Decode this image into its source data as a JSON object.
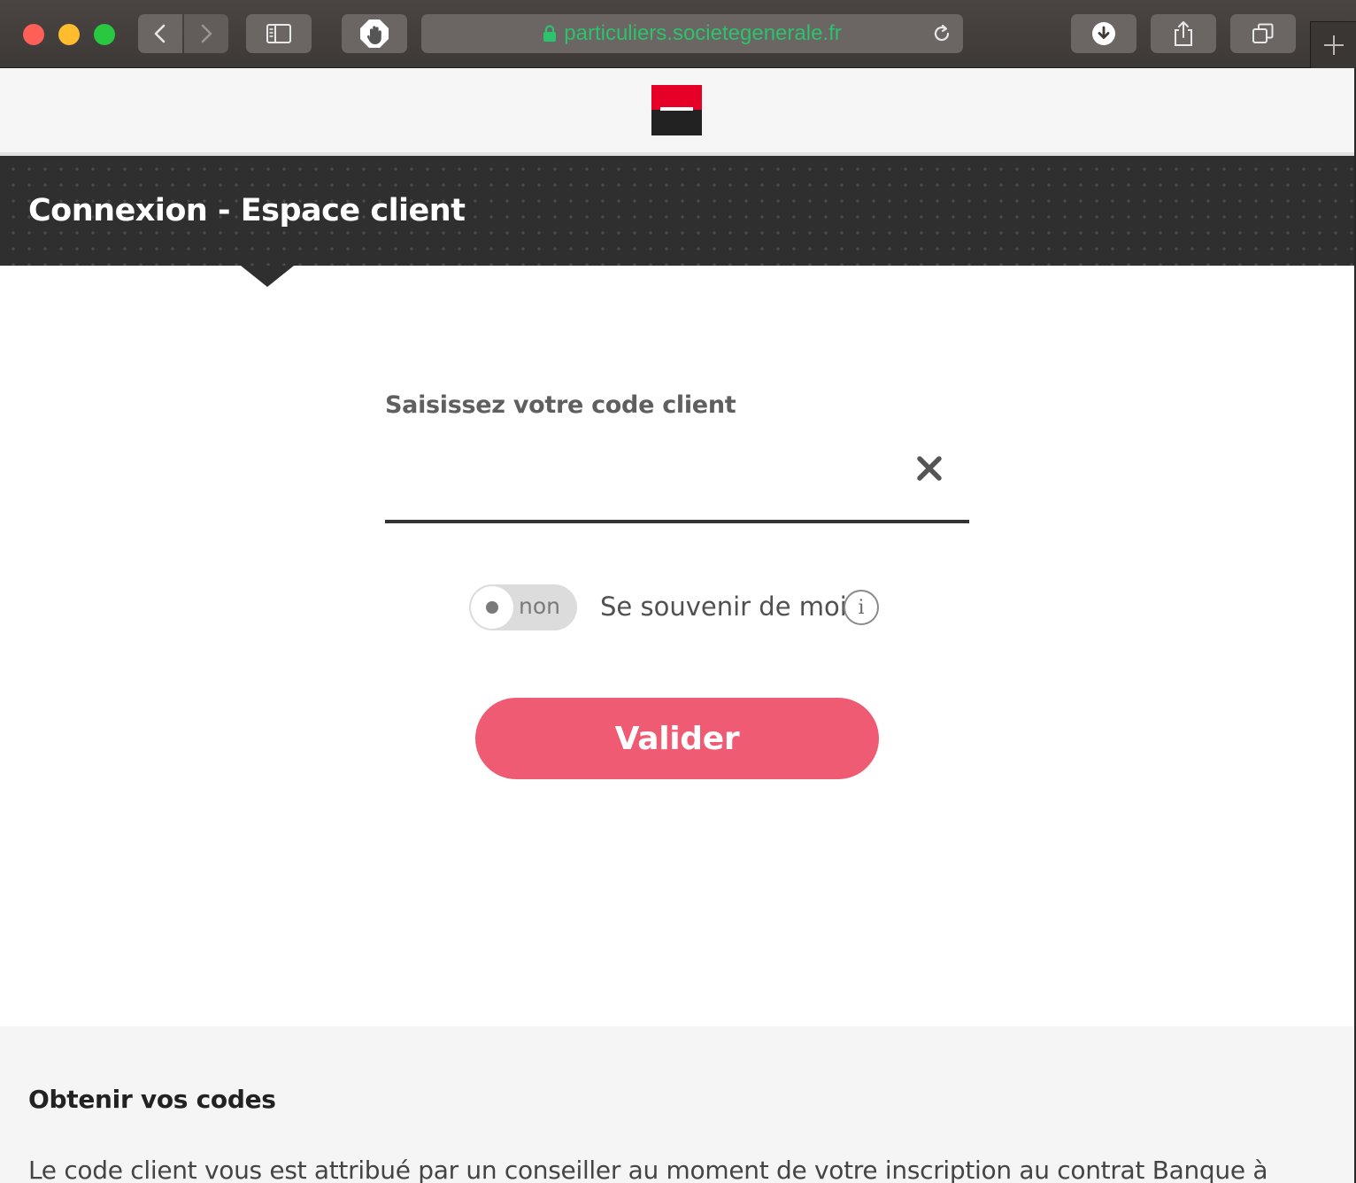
{
  "browser": {
    "url": "particuliers.societegenerale.fr",
    "colors": {
      "url_text": "#2bc36b",
      "chrome": "#3d3937"
    }
  },
  "brand": {
    "colors": {
      "red": "#e60028",
      "black": "#222222"
    }
  },
  "hero": {
    "title": "Connexion - Espace client"
  },
  "login": {
    "label": "Saisissez votre code client",
    "code_value": "",
    "remember_toggle_state": "non",
    "remember_label": "Se souvenir de moi",
    "info_glyph": "i",
    "submit_label": "Valider",
    "colors": {
      "submit": "#ef5b73"
    }
  },
  "codes": {
    "title": "Obtenir vos codes",
    "text": "Le code client vous est attribué par un conseiller au moment de votre inscription au contrat Banque à"
  }
}
